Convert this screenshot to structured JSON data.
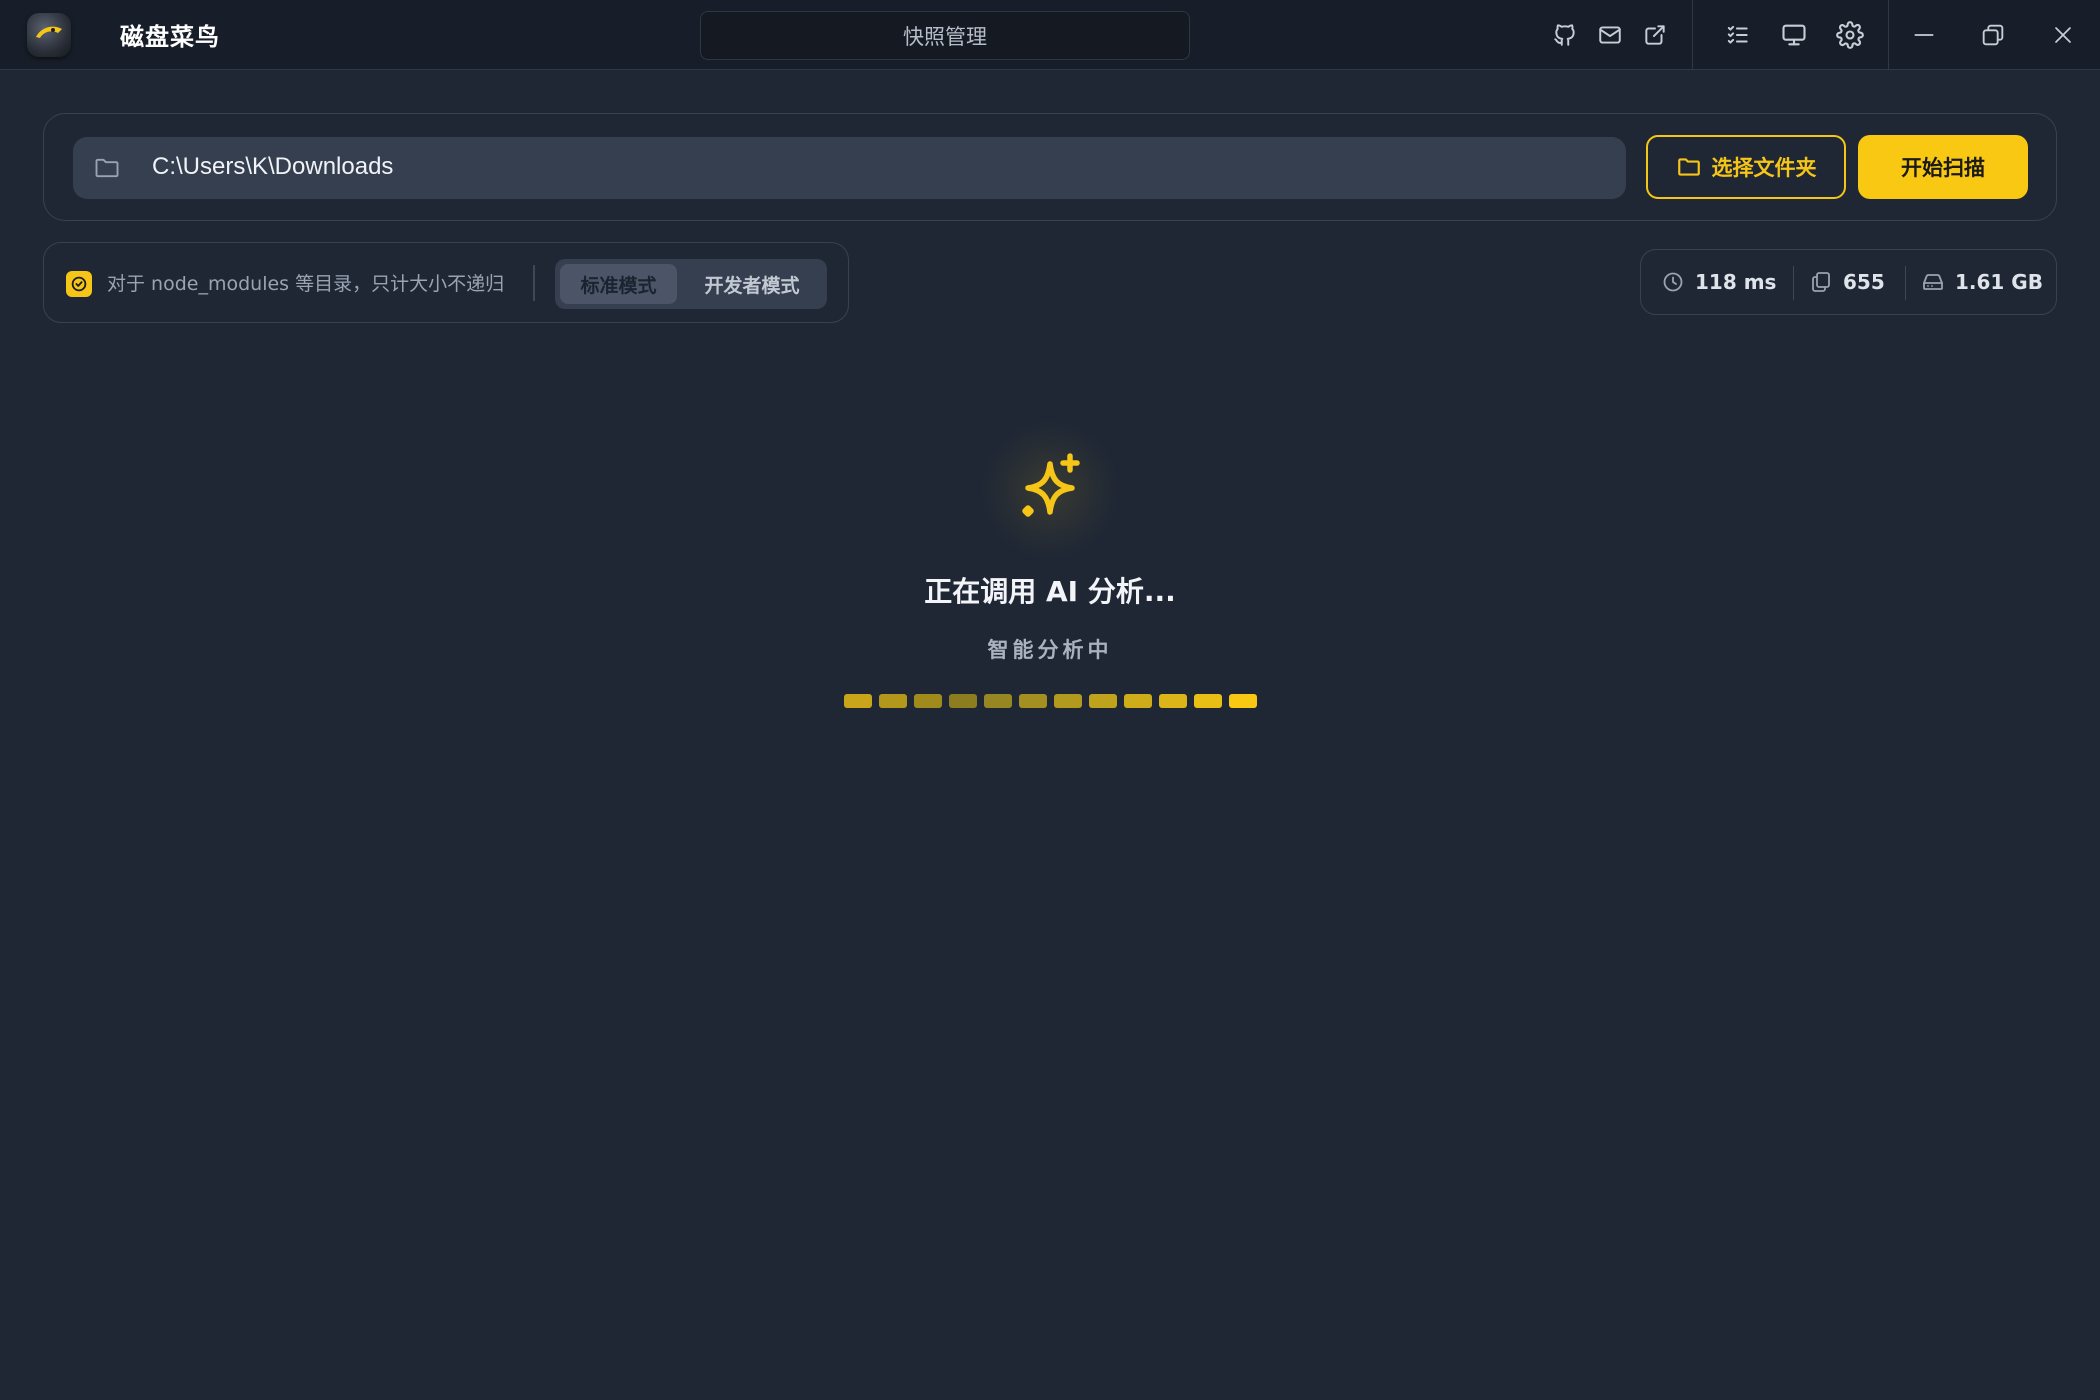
{
  "app": {
    "title": "磁盘菜鸟",
    "snapshot_button": "快照管理"
  },
  "titlebar_icons": [
    "github-icon",
    "mail-icon",
    "external-link-icon",
    "checklist-icon",
    "monitor-icon",
    "settings-icon",
    "minimize-icon",
    "restore-icon",
    "close-icon"
  ],
  "path_bar": {
    "path_value": "C:\\Users\\K\\Downloads",
    "choose_folder_label": "选择文件夹",
    "start_scan_label": "开始扫描"
  },
  "options": {
    "skip_node_modules_label": "对于 node_modules 等目录，只计大小不递归",
    "skip_node_modules_checked": true,
    "modes": [
      "标准模式",
      "开发者模式"
    ],
    "active_mode": "标准模式"
  },
  "stats": {
    "time": "118 ms",
    "files": "655",
    "size": "1.61 GB"
  },
  "loading": {
    "title": "正在调用 AI 分析...",
    "subtitle": "智能分析中",
    "segments_total": 12
  },
  "colors": {
    "accent": "#f5c518",
    "background": "#1f2735",
    "titlebar": "#181e29",
    "panel_border": "#394252",
    "input_bg": "#353f50"
  }
}
